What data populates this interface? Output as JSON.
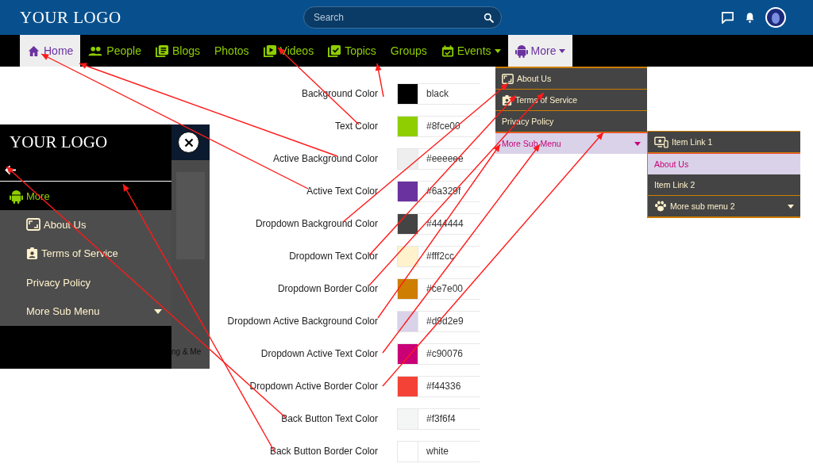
{
  "header": {
    "logo": "YOUR LOGO",
    "search": {
      "placeholder": "Search"
    }
  },
  "nav": [
    {
      "label": "Home",
      "kind": "home",
      "selected": true,
      "dropdown": false
    },
    {
      "label": "People",
      "kind": "people",
      "selected": false,
      "dropdown": false
    },
    {
      "label": "Blogs",
      "kind": "blogs",
      "selected": false,
      "dropdown": false
    },
    {
      "label": "Photos",
      "kind": "plain",
      "selected": false,
      "dropdown": false
    },
    {
      "label": "Videos",
      "kind": "videos",
      "selected": false,
      "dropdown": false
    },
    {
      "label": "Topics",
      "kind": "topics",
      "selected": false,
      "dropdown": false
    },
    {
      "label": "Groups",
      "kind": "plain",
      "selected": false,
      "dropdown": false
    },
    {
      "label": "Events",
      "kind": "events",
      "selected": false,
      "dropdown": true
    },
    {
      "label": "More",
      "kind": "android",
      "selected": true,
      "dropdown": true
    }
  ],
  "mobile": {
    "logo": "YOUR LOGO",
    "active_item": "More",
    "background_snippet": "ng & Me",
    "items": [
      {
        "label": "About Us",
        "kind": "frame",
        "submenu": false
      },
      {
        "label": "Terms of Service",
        "kind": "badge",
        "submenu": false
      },
      {
        "label": "Privacy Policy",
        "kind": "plain",
        "submenu": false
      },
      {
        "label": "More Sub Menu",
        "kind": "plain",
        "submenu": true
      }
    ]
  },
  "colors": [
    {
      "label": "Background Color",
      "value": "black",
      "color": "#000000"
    },
    {
      "label": "Text Color",
      "value": "#8fce00",
      "color": "#8fce00"
    },
    {
      "label": "Active Background Color",
      "value": "#eeeeee",
      "color": "#eeeeee"
    },
    {
      "label": "Active Text Color",
      "value": "#6a329f",
      "color": "#6a329f"
    },
    {
      "label": "Dropdown Background Color",
      "value": "#444444",
      "color": "#444444"
    },
    {
      "label": "Dropdown Text Color",
      "value": "#fff2cc",
      "color": "#fff2cc"
    },
    {
      "label": "Dropdown Border Color",
      "value": "#ce7e00",
      "color": "#ce7e00"
    },
    {
      "label": "Dropdown Active Background Color",
      "value": "#d9d2e9",
      "color": "#d9d2e9"
    },
    {
      "label": "Dropdown Active Text Color",
      "value": "#c90076",
      "color": "#c90076"
    },
    {
      "label": "Dropdown Active Border Color",
      "value": "#f44336",
      "color": "#f44336"
    },
    {
      "label": "Back Button Text Color",
      "value": "#f3f6f4",
      "color": "#f3f6f4"
    },
    {
      "label": "Back Button Border Color",
      "value": "white",
      "color": "#ffffff"
    }
  ],
  "dropdown": {
    "items": [
      {
        "label": "About Us",
        "kind": "frame",
        "selected": false,
        "submenu": false
      },
      {
        "label": "Terms of Service",
        "kind": "badge",
        "selected": false,
        "submenu": false
      },
      {
        "label": "Privacy Policy",
        "kind": "plain",
        "selected": false,
        "submenu": false
      },
      {
        "label": "More Sub Menu",
        "kind": "plain",
        "selected": true,
        "submenu": true
      }
    ],
    "subitems": [
      {
        "label": "Item Link 1",
        "kind": "devices",
        "selected": false,
        "submenu": false
      },
      {
        "label": "About Us",
        "kind": "plain",
        "selected": true,
        "submenu": false
      },
      {
        "label": "Item Link 2",
        "kind": "plain",
        "selected": false,
        "submenu": false
      },
      {
        "label": "More sub menu 2",
        "kind": "paw",
        "selected": false,
        "submenu": true
      }
    ]
  }
}
